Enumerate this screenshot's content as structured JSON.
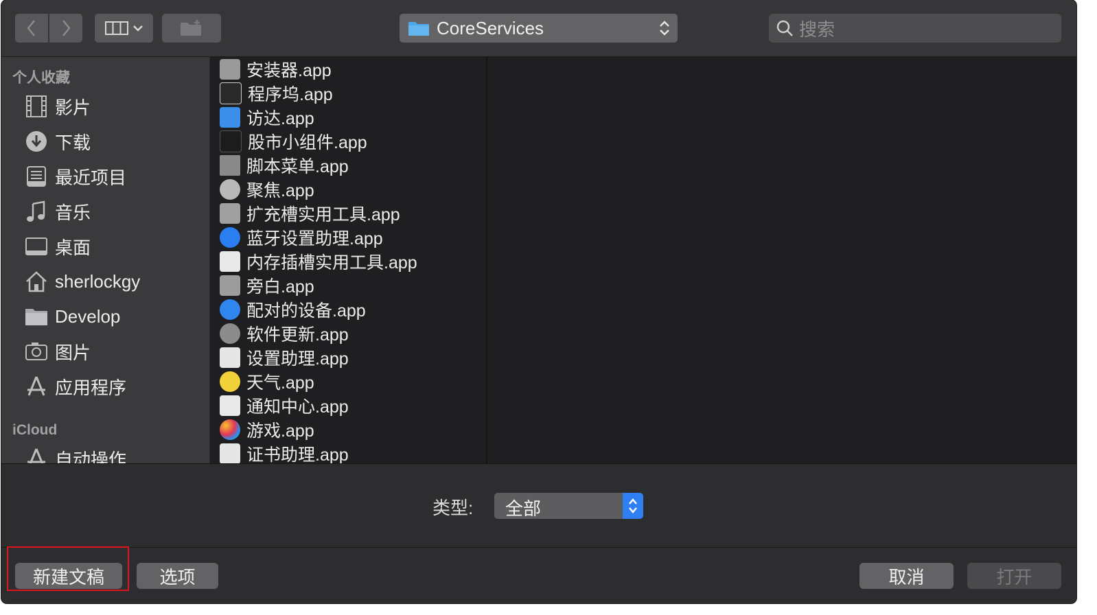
{
  "toolbar": {
    "path_label": "CoreServices",
    "search_placeholder": "搜索"
  },
  "sidebar": {
    "favorites_header": "个人收藏",
    "favorites": [
      {
        "label": "影片",
        "icon": "movies-icon"
      },
      {
        "label": "下载",
        "icon": "downloads-icon"
      },
      {
        "label": "最近项目",
        "icon": "recents-icon"
      },
      {
        "label": "音乐",
        "icon": "music-icon"
      },
      {
        "label": "桌面",
        "icon": "desktop-icon"
      },
      {
        "label": "sherlockgy",
        "icon": "home-icon"
      },
      {
        "label": "Develop",
        "icon": "folder-icon"
      },
      {
        "label": "图片",
        "icon": "pictures-icon"
      },
      {
        "label": "应用程序",
        "icon": "applications-icon"
      }
    ],
    "icloud_header": "iCloud",
    "icloud": [
      {
        "label": "自动操作",
        "icon": "automator-icon"
      }
    ]
  },
  "files": [
    {
      "name": "安装器.app",
      "icon": "installer-icon"
    },
    {
      "name": "程序坞.app",
      "icon": "dock-icon"
    },
    {
      "name": "访达.app",
      "icon": "finder-icon"
    },
    {
      "name": "股市小组件.app",
      "icon": "stocks-widget-icon"
    },
    {
      "name": "脚本菜单.app",
      "icon": "script-menu-icon"
    },
    {
      "name": "聚焦.app",
      "icon": "spotlight-icon"
    },
    {
      "name": "扩充槽实用工具.app",
      "icon": "expansion-slot-icon"
    },
    {
      "name": "蓝牙设置助理.app",
      "icon": "bluetooth-icon"
    },
    {
      "name": "内存插槽实用工具.app",
      "icon": "memory-slot-icon"
    },
    {
      "name": "旁白.app",
      "icon": "voiceover-icon"
    },
    {
      "name": "配对的设备.app",
      "icon": "paired-devices-icon"
    },
    {
      "name": "软件更新.app",
      "icon": "software-update-icon"
    },
    {
      "name": "设置助理.app",
      "icon": "setup-assistant-icon"
    },
    {
      "name": "天气.app",
      "icon": "weather-icon"
    },
    {
      "name": "通知中心.app",
      "icon": "notification-center-icon"
    },
    {
      "name": "游戏.app",
      "icon": "game-center-icon"
    },
    {
      "name": "证书助理.app",
      "icon": "certificate-assistant-icon"
    }
  ],
  "bottom": {
    "type_label": "类型:",
    "type_value": "全部",
    "new_doc_label": "新建文稿",
    "options_label": "选项",
    "cancel_label": "取消",
    "open_label": "打开"
  },
  "colors": {
    "accent": "#2f7ef2",
    "highlight": "#e0141c"
  }
}
